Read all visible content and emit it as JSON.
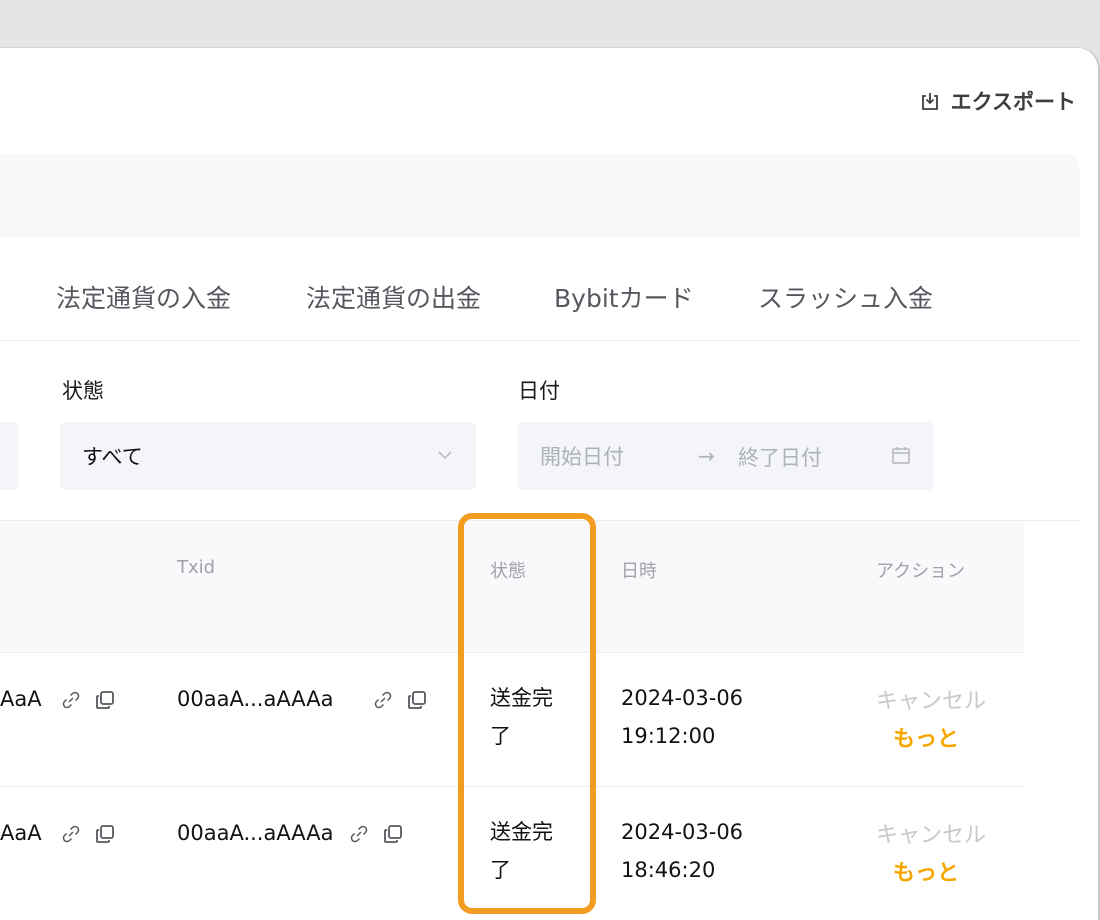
{
  "header": {
    "export_label": "エクスポート"
  },
  "tabs": [
    {
      "label": "法定通貨の入金"
    },
    {
      "label": "法定通貨の出金"
    },
    {
      "label": "Bybitカード"
    },
    {
      "label": "スラッシュ入金"
    }
  ],
  "filters": {
    "status_label": "状態",
    "status_value": "すべて",
    "date_label": "日付",
    "date_start_placeholder": "開始日付",
    "date_arrow": "→",
    "date_end_placeholder": "終了日付"
  },
  "table": {
    "columns": {
      "txid": "Txid",
      "status": "状態",
      "datetime": "日時",
      "action": "アクション"
    },
    "rows": [
      {
        "address": "AaA",
        "txid": "00aaA...aAAAa",
        "status": "送金完了",
        "date": "2024-03-06",
        "time": "19:12:00",
        "cancel": "キャンセル",
        "more": "もっと"
      },
      {
        "address": "AaA",
        "txid": "00aaA...aAAAa",
        "status": "送金完了",
        "date": "2024-03-06",
        "time": "18:46:20",
        "cancel": "キャンセル",
        "more": "もっと"
      }
    ]
  },
  "colors": {
    "accent": "#f7a600",
    "highlight": "#f29d22"
  }
}
